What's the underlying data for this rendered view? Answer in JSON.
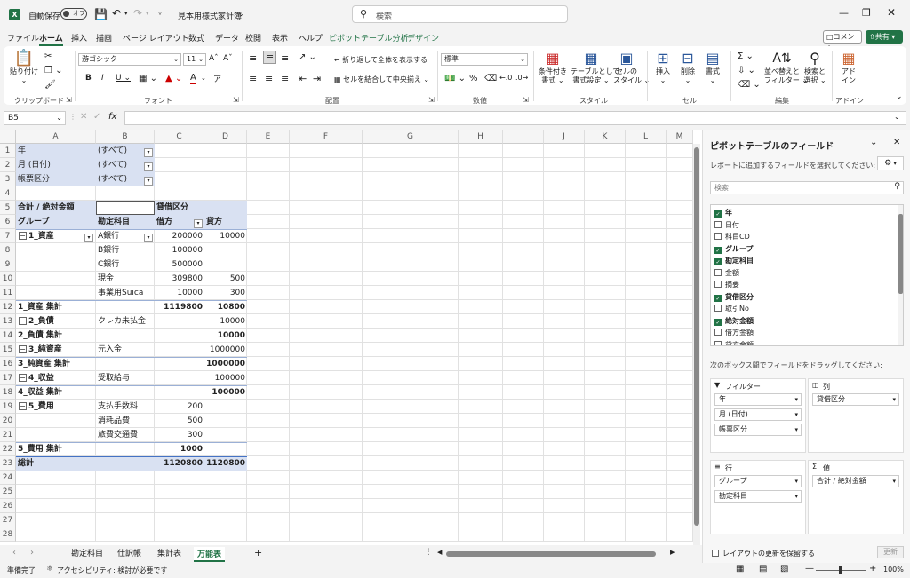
{
  "titlebar": {
    "autosave": "自動保存",
    "toggle": "オフ",
    "filename": "見本用様式家計簿",
    "search": "検索"
  },
  "menu": [
    {
      "label": "ファイル"
    },
    {
      "label": "ホーム"
    },
    {
      "label": "挿入"
    },
    {
      "label": "描画"
    },
    {
      "label": "ページ レイアウト"
    },
    {
      "label": "数式"
    },
    {
      "label": "データ"
    },
    {
      "label": "校閲"
    },
    {
      "label": "表示"
    },
    {
      "label": "ヘルプ"
    },
    {
      "label": "ピボットテーブル分析"
    },
    {
      "label": "デザイン"
    }
  ],
  "menu_right": {
    "comment": "コメント",
    "share": "共有"
  },
  "ribbon": {
    "paste": "貼り付け",
    "clipboard": "クリップボード",
    "font_name": "游ゴシック",
    "font_size": "11",
    "font": "フォント",
    "wrap": "折り返して全体を表示する",
    "merge": "セルを結合して中央揃え",
    "align": "配置",
    "numfmt": "標準",
    "number": "数値",
    "cond": "条件付き",
    "cond2": "書式",
    "table": "テーブルとして",
    "table2": "書式設定",
    "cellstyle": "セルの",
    "cellstyle2": "スタイル",
    "style": "スタイル",
    "insert": "挿入",
    "delete": "削除",
    "format": "書式",
    "cells": "セル",
    "sort": "並べ替えと",
    "sort2": "フィルター",
    "find": "検索と",
    "find2": "選択",
    "edit": "編集",
    "addin": "アド",
    "addin2": "イン",
    "addins": "アドイン"
  },
  "formula": {
    "namebox": "B5",
    "fx": "fx"
  },
  "columns": [
    "A",
    "B",
    "C",
    "D",
    "E",
    "F",
    "G",
    "H",
    "I",
    "J",
    "K",
    "L",
    "M"
  ],
  "rows": [
    "1",
    "2",
    "3",
    "4",
    "5",
    "6",
    "7",
    "8",
    "9",
    "10",
    "11",
    "12",
    "13",
    "14",
    "15",
    "16",
    "17",
    "18",
    "19",
    "20",
    "21",
    "22",
    "23",
    "24",
    "25",
    "26",
    "27",
    "28"
  ],
  "cells": {
    "a1": "年",
    "b1": "(すべて)",
    "a2": "月 (日付)",
    "b2": "(すべて)",
    "a3": "帳票区分",
    "b3": "(すべて)",
    "a5": "合計 / 絶対金額",
    "c5": "貸借区分",
    "a6": "グループ",
    "b6": "勘定科目",
    "c6": "借方",
    "d6": "貸方",
    "a7": "1_資産",
    "b7": "A銀行",
    "c7": "200000",
    "d7": "10000",
    "b8": "B銀行",
    "c8": "100000",
    "b9": "C銀行",
    "c9": "500000",
    "b10": "現金",
    "c10": "309800",
    "d10": "500",
    "b11": "事業用Suica",
    "c11": "10000",
    "d11": "300",
    "a12": "1_資産 集計",
    "c12": "1119800",
    "d12": "10800",
    "a13": "2_負債",
    "b13": "クレカ未払金",
    "d13": "10000",
    "a14": "2_負債 集計",
    "d14": "10000",
    "a15": "3_純資産",
    "b15": "元入金",
    "d15": "1000000",
    "a16": "3_純資産 集計",
    "d16": "1000000",
    "a17": "4_収益",
    "b17": "受取給与",
    "d17": "100000",
    "a18": "4_収益 集計",
    "d18": "100000",
    "a19": "5_費用",
    "b19": "支払手数料",
    "c19": "200",
    "b20": "消耗品費",
    "c20": "500",
    "b21": "旅費交通費",
    "c21": "300",
    "a22": "5_費用 集計",
    "c22": "1000",
    "a23": "総計",
    "c23": "1120800",
    "d23": "1120800"
  },
  "tabs": [
    {
      "label": "勘定科目"
    },
    {
      "label": "仕訳帳"
    },
    {
      "label": "集計表"
    },
    {
      "label": "万能表"
    }
  ],
  "pivot": {
    "title": "ピボットテーブルのフィールド",
    "subtitle": "レポートに追加するフィールドを選択してください:",
    "search": "検索",
    "fields": [
      {
        "label": "年",
        "on": true
      },
      {
        "label": "日付",
        "on": false
      },
      {
        "label": "科目CD",
        "on": false
      },
      {
        "label": "グループ",
        "on": true
      },
      {
        "label": "勘定科目",
        "on": true
      },
      {
        "label": "金額",
        "on": false
      },
      {
        "label": "摘要",
        "on": false
      },
      {
        "label": "貸借区分",
        "on": true
      },
      {
        "label": "取引No",
        "on": false
      },
      {
        "label": "絶対金額",
        "on": true
      },
      {
        "label": "借方金額",
        "on": false
      },
      {
        "label": "貸方金額",
        "on": false
      }
    ],
    "drag": "次のボックス間でフィールドをドラッグしてください:",
    "filter": "フィルター",
    "col": "列",
    "row": "行",
    "val": "値",
    "filter_items": [
      "年",
      "月 (日付)",
      "帳票区分"
    ],
    "col_items": [
      "貸借区分"
    ],
    "row_items": [
      "グループ",
      "勘定科目"
    ],
    "val_items": [
      "合計 / 絶対金額"
    ],
    "defer": "レイアウトの更新を保留する",
    "update": "更新"
  },
  "status": {
    "ready": "準備完了",
    "access": "アクセシビリティ: 検討が必要です",
    "zoom": "100%"
  }
}
